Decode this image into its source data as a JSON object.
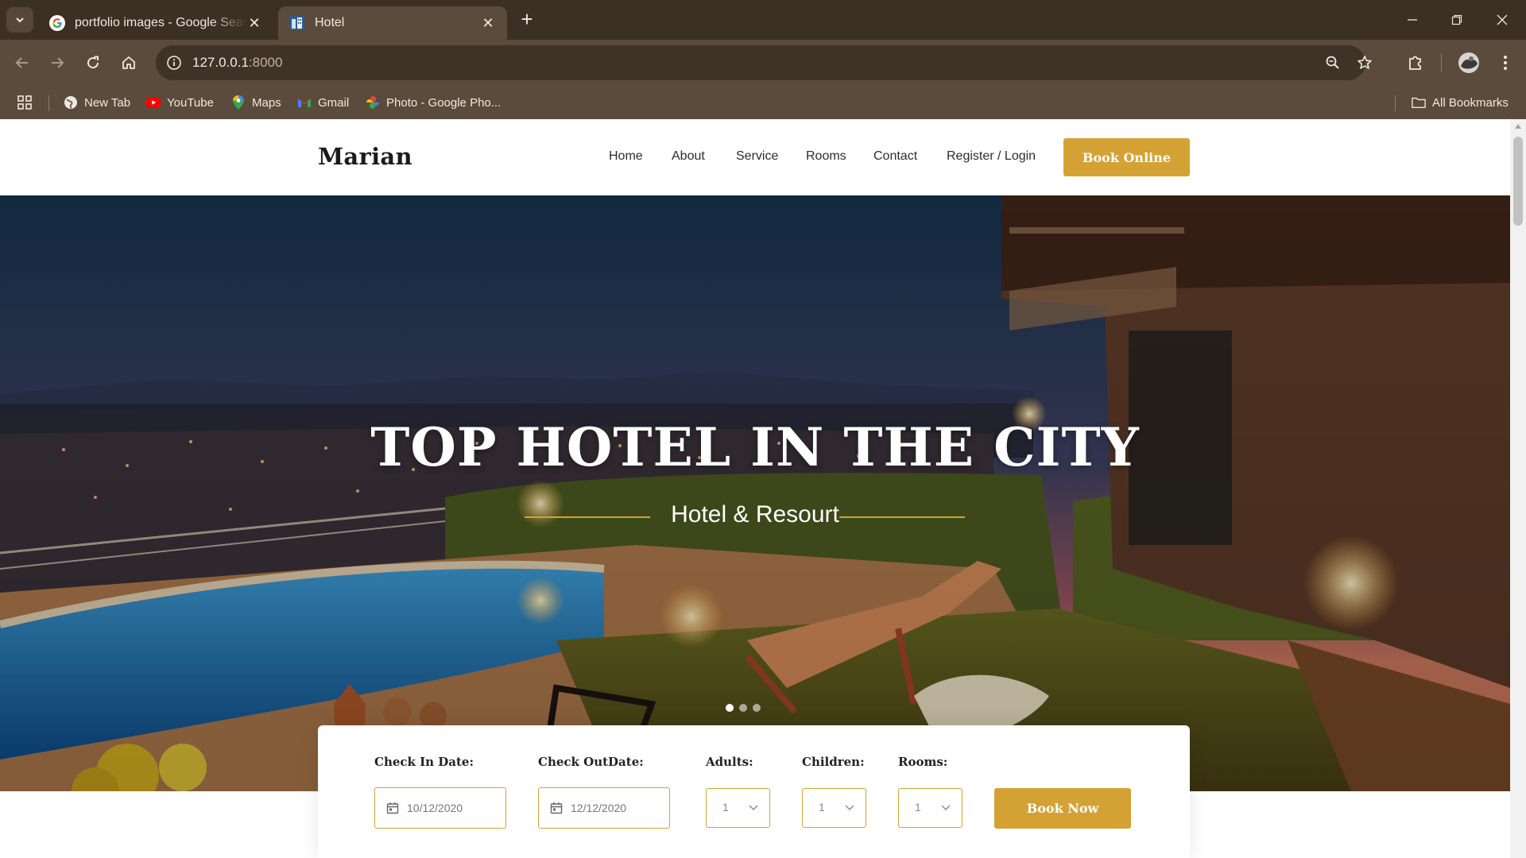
{
  "browser": {
    "tabs": [
      {
        "title": "portfolio images - Google Search",
        "active": false
      },
      {
        "title": "Hotel",
        "active": true
      }
    ],
    "url_host": "127.0.0.1",
    "url_port": ":8000",
    "bookmarks": [
      {
        "label": "New Tab",
        "icon": "globe-icon"
      },
      {
        "label": "YouTube",
        "icon": "youtube-icon"
      },
      {
        "label": "Maps",
        "icon": "maps-icon"
      },
      {
        "label": "Gmail",
        "icon": "gmail-icon"
      },
      {
        "label": "Photo - Google Pho...",
        "icon": "photos-icon"
      }
    ],
    "all_bookmarks": "All Bookmarks",
    "colors": {
      "frame": "#3c2f23",
      "toolbar": "#5a4b3c"
    }
  },
  "site": {
    "logo": "Marian",
    "nav": [
      "Home",
      "About",
      "Service",
      "Rooms",
      "Contact",
      "Register / Login"
    ],
    "cta": "Book Online",
    "accent_color": "#d4a234"
  },
  "hero": {
    "title": "TOP HOTEL IN THE CITY",
    "subtitle": "Hotel & Resourt",
    "slides": 3,
    "active_slide": 1
  },
  "booking": {
    "check_in_label": "Check In Date:",
    "check_in_value": "10/12/2020",
    "check_out_label": "Check OutDate:",
    "check_out_value": "12/12/2020",
    "adults_label": "Adults:",
    "adults_value": "1",
    "children_label": "Children:",
    "children_value": "1",
    "rooms_label": "Rooms:",
    "rooms_value": "1",
    "submit": "Book Now"
  }
}
